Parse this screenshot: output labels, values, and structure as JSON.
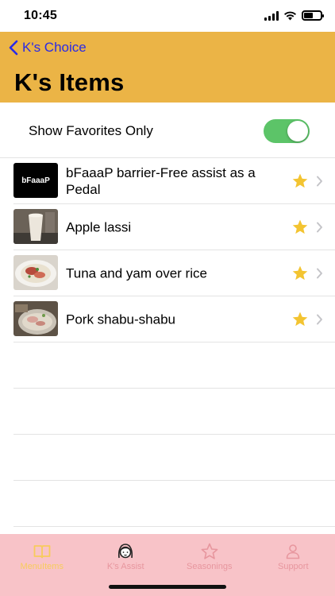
{
  "status_bar": {
    "time": "10:45"
  },
  "header": {
    "back_label": "K's Choice",
    "title": "K's Items",
    "color": "#ebb446",
    "back_color": "#2a2ae6"
  },
  "favorites": {
    "label": "Show Favorites Only",
    "enabled": true,
    "toggle_color": "#5cc468"
  },
  "items": [
    {
      "title": "bFaaaP barrier-Free assist as a Pedal",
      "thumb_icon": "bfaaap-logo",
      "thumb_text": "bFaaaP",
      "favorite": true
    },
    {
      "title": "Apple lassi",
      "thumb_icon": "apple-lassi-photo",
      "favorite": true
    },
    {
      "title": "Tuna and yam over rice",
      "thumb_icon": "tuna-yam-rice-photo",
      "favorite": true
    },
    {
      "title": "Pork shabu-shabu",
      "thumb_icon": "pork-shabu-shabu-photo",
      "favorite": true
    }
  ],
  "star_color": "#f3c431",
  "tabbar": {
    "background": "#f8c3c8",
    "active_color": "#f7cc5c",
    "inactive_color": "#e7969e",
    "tabs": [
      {
        "label": "MenuItems",
        "icon": "book-icon",
        "active": true
      },
      {
        "label": "K's Assist",
        "icon": "girl-face-icon",
        "active": false
      },
      {
        "label": "Seasonings",
        "icon": "star-outline-icon",
        "active": false
      },
      {
        "label": "Support",
        "icon": "person-icon",
        "active": false
      }
    ]
  }
}
